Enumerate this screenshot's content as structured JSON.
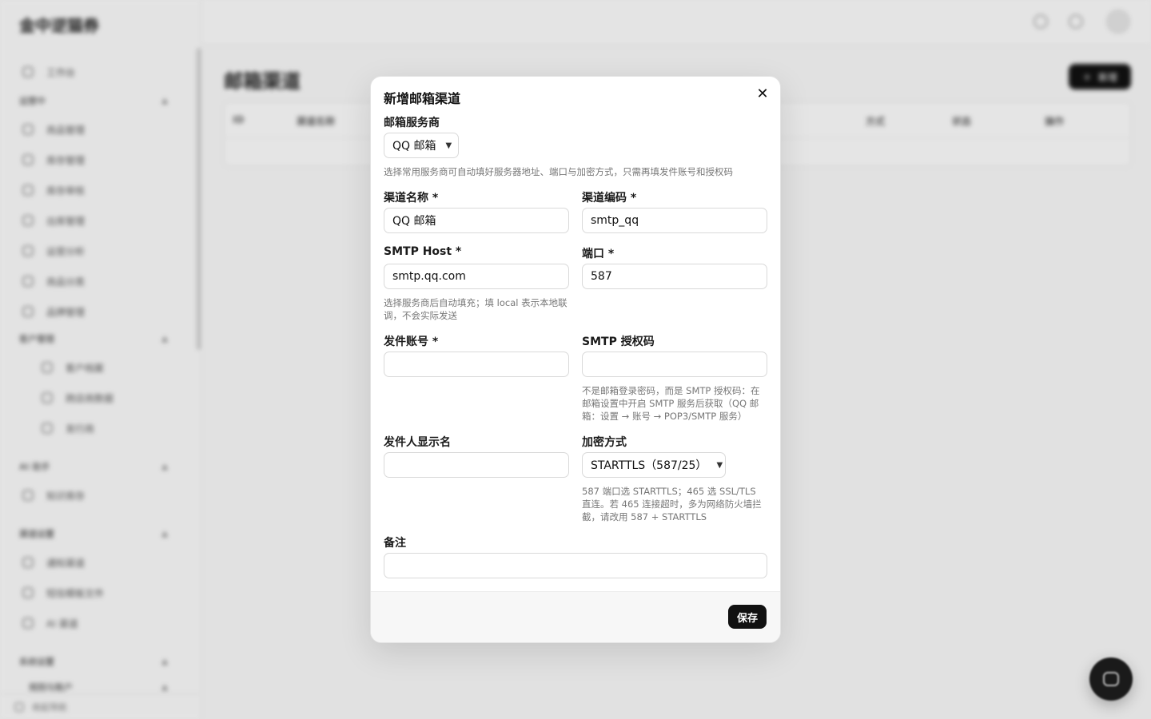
{
  "app": {
    "brand": "金中逆猫券",
    "page_title": "邮箱渠道",
    "new_button": "新增",
    "sidebar": {
      "top_item": "工作台",
      "groups": [
        {
          "label": "运营中",
          "items": [
            "商品管理",
            "库存管理",
            "库存审核",
            "出库管理",
            "运营分析",
            "商品分类",
            "品牌管理"
          ]
        },
        {
          "label": "客户管理",
          "items": [
            "客户档案",
            "跨店商数据",
            "发行商"
          ]
        },
        {
          "label": "AI 助手",
          "items": [
            "知识库存"
          ]
        },
        {
          "label": "渠道设置",
          "items": [
            "通知渠道",
            "短信模板文件",
            "AI 渠道"
          ]
        },
        {
          "label": "系统设置",
          "items": []
        },
        {
          "label": "规则与账户",
          "items": []
        }
      ],
      "footer": "收起导航"
    },
    "table_headers": [
      "ID",
      "渠道名称",
      "方式",
      "状态",
      "操作"
    ]
  },
  "modal": {
    "title": "新增邮箱渠道",
    "close_icon": "close-icon",
    "provider": {
      "label": "邮箱服务商",
      "selected": "QQ 邮箱",
      "hint": "选择常用服务商可自动填好服务器地址、端口与加密方式，只需再填发件账号和授权码"
    },
    "channel_name": {
      "label": "渠道名称 *",
      "value": "QQ 邮箱"
    },
    "channel_code": {
      "label": "渠道编码 *",
      "value": "smtp_qq"
    },
    "smtp_host": {
      "label": "SMTP Host *",
      "value": "smtp.qq.com",
      "hint": "选择服务商后自动填充；填 local 表示本地联调，不会实际发送"
    },
    "port": {
      "label": "端口 *",
      "value": "587"
    },
    "sender_account": {
      "label": "发件账号 *",
      "value": ""
    },
    "smtp_auth": {
      "label": "SMTP 授权码",
      "value": "",
      "hint": "不是邮箱登录密码，而是 SMTP 授权码：在邮箱设置中开启 SMTP 服务后获取（QQ 邮箱：设置 → 账号 → POP3/SMTP 服务）"
    },
    "sender_name": {
      "label": "发件人显示名",
      "value": ""
    },
    "encryption": {
      "label": "加密方式",
      "selected": "STARTTLS（587/25）",
      "hint": "587 端口选 STARTTLS；465 选 SSL/TLS 直连。若 465 连接超时，多为网络防火墙拦截，请改用 587 + STARTTLS"
    },
    "remark": {
      "label": "备注",
      "value": ""
    },
    "save_button": "保存"
  },
  "colors": {
    "primary": "#111111",
    "hint": "#777777",
    "border": "#d9d9d9",
    "backdrop": "#f3f3f3"
  }
}
